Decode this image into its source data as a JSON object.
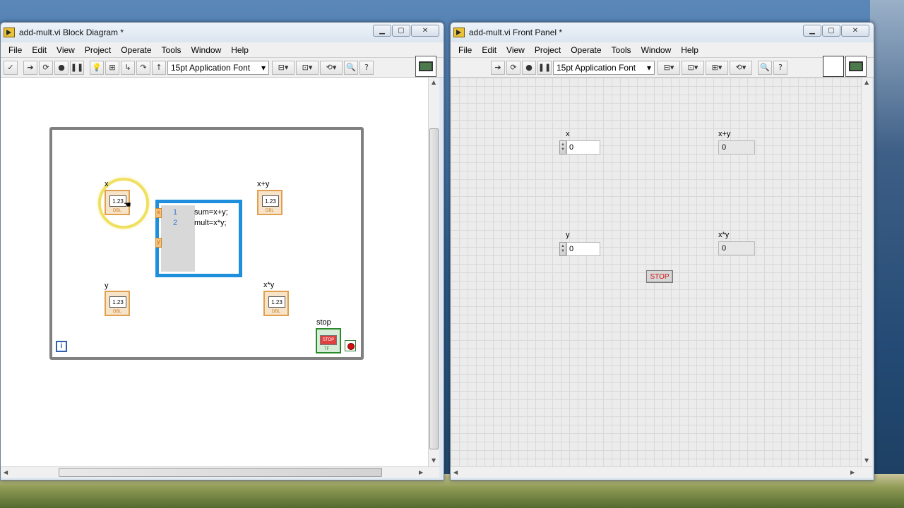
{
  "block_diagram": {
    "title": "add-mult.vi Block Diagram *",
    "menu": [
      "File",
      "Edit",
      "View",
      "Project",
      "Operate",
      "Tools",
      "Window",
      "Help"
    ],
    "font_select": "15pt Application Font",
    "controls": [
      {
        "id": "x",
        "label": "x",
        "value": "1.23",
        "rep": "DBL"
      },
      {
        "id": "y",
        "label": "y",
        "value": "1.23",
        "rep": "DBL"
      }
    ],
    "indicators": [
      {
        "id": "sum",
        "label": "x+y",
        "value": "1.23",
        "rep": "DBL"
      },
      {
        "id": "prod",
        "label": "x*y",
        "value": "1.23",
        "rep": "DBL"
      }
    ],
    "mathscript": {
      "line_numbers": [
        "1",
        "2"
      ],
      "lines": [
        "sum=x+y;",
        "mult=x*y;"
      ],
      "inputs": [
        "x",
        "y"
      ]
    },
    "stop": {
      "label": "stop",
      "text": "STOP",
      "rep": "TF"
    },
    "iteration": "i"
  },
  "front_panel": {
    "title": "add-mult.vi Front Panel *",
    "menu": [
      "File",
      "Edit",
      "View",
      "Project",
      "Operate",
      "Tools",
      "Window",
      "Help"
    ],
    "font_select": "15pt Application Font",
    "controls": [
      {
        "label": "x",
        "value": "0"
      },
      {
        "label": "y",
        "value": "0"
      }
    ],
    "indicators": [
      {
        "label": "x+y",
        "value": "0"
      },
      {
        "label": "x*y",
        "value": "0"
      }
    ],
    "stop_button": "STOP"
  },
  "window_controls": {
    "minimize": "▁",
    "maximize": "▢",
    "close": "✕"
  },
  "colors": {
    "math_border": "#1e8fdc",
    "dbl_orange": "#e0a050",
    "bool_green": "#2a8a2a",
    "highlight": "#f0e060"
  }
}
